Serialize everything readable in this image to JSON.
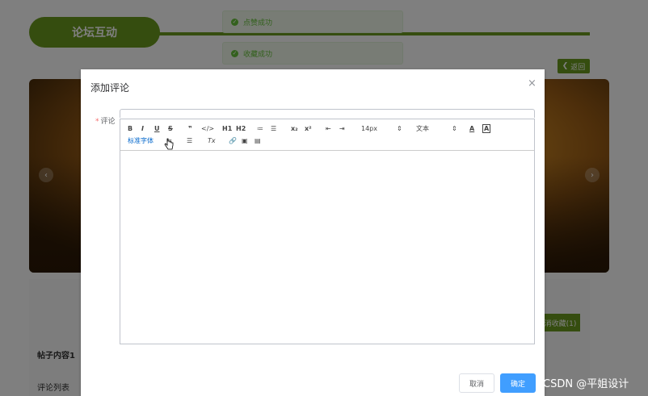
{
  "background": {
    "forum_title": "论坛互动",
    "back_label": "返回",
    "back_icon": "chevron-left-icon",
    "favorite_label": "取消收藏(1)",
    "post_content": "帖子内容1",
    "comment_list": "评论列表",
    "toasts": [
      "点赞成功",
      "收藏成功"
    ]
  },
  "dialog": {
    "title": "添加评论",
    "close": "×",
    "field_label": "评论",
    "required_mark": "*",
    "toolbar": {
      "bold": "B",
      "italic": "I",
      "underline": "U",
      "strike": "S",
      "quote": "❞",
      "code": "</>",
      "h1": "H1",
      "h2": "H2",
      "ordered_list": "≔",
      "bullet_list": "☰",
      "subscript": "x₂",
      "superscript": "x²",
      "outdent": "⇤",
      "indent": "⇥",
      "size_value": "14px",
      "size_arrow": "⇕",
      "header_value": "文本",
      "header_arrow": "⇕",
      "font_color": "A",
      "background_color": "A",
      "font_family": "标准字体",
      "direction": "⇆",
      "align": "☰",
      "clean": "Tx",
      "link": "🔗",
      "image": "▣",
      "video": "▤"
    },
    "cancel_label": "取消",
    "confirm_label": "确定"
  },
  "watermark": "CSDN @平姐设计",
  "colors": {
    "brand_green": "#6a9a1f",
    "primary_blue": "#409eff",
    "success_green": "#67c23a"
  }
}
